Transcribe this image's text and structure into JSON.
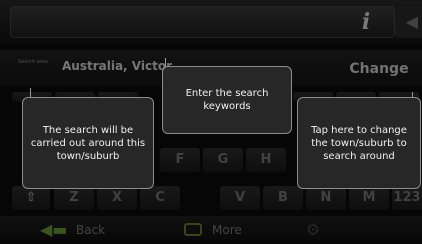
{
  "topbar": {
    "info_icon": "i",
    "backspace_icon": "◀"
  },
  "location": {
    "label": "Search area",
    "value": "Australia, Victor",
    "change_label": "Change"
  },
  "keyboard": {
    "row_bottom": [
      {
        "label": "⇧",
        "name": "shift-key"
      },
      {
        "label": "Z",
        "name": "key-z"
      },
      {
        "label": "X",
        "name": "key-x"
      },
      {
        "label": "C",
        "name": "key-c"
      },
      {
        "label": "V",
        "name": "key-v"
      },
      {
        "label": "B",
        "name": "key-b"
      },
      {
        "label": "N",
        "name": "key-n"
      },
      {
        "label": "M",
        "name": "key-m"
      },
      {
        "label": "123",
        "name": "key-numbers"
      }
    ],
    "row_mid_visible": [
      "F",
      "G",
      "H"
    ]
  },
  "bottombar": {
    "back_label": "Back",
    "more_label": "More"
  },
  "callouts": {
    "area": "The search will be carried out around this town/suburb",
    "keywords": "Enter the search keywords",
    "change": "Tap here to change the town/suburb to search around"
  },
  "colors": {
    "accent_green": "#6a9a3a",
    "callout_bg": "#272727",
    "callout_border": "#8c8c8c"
  }
}
